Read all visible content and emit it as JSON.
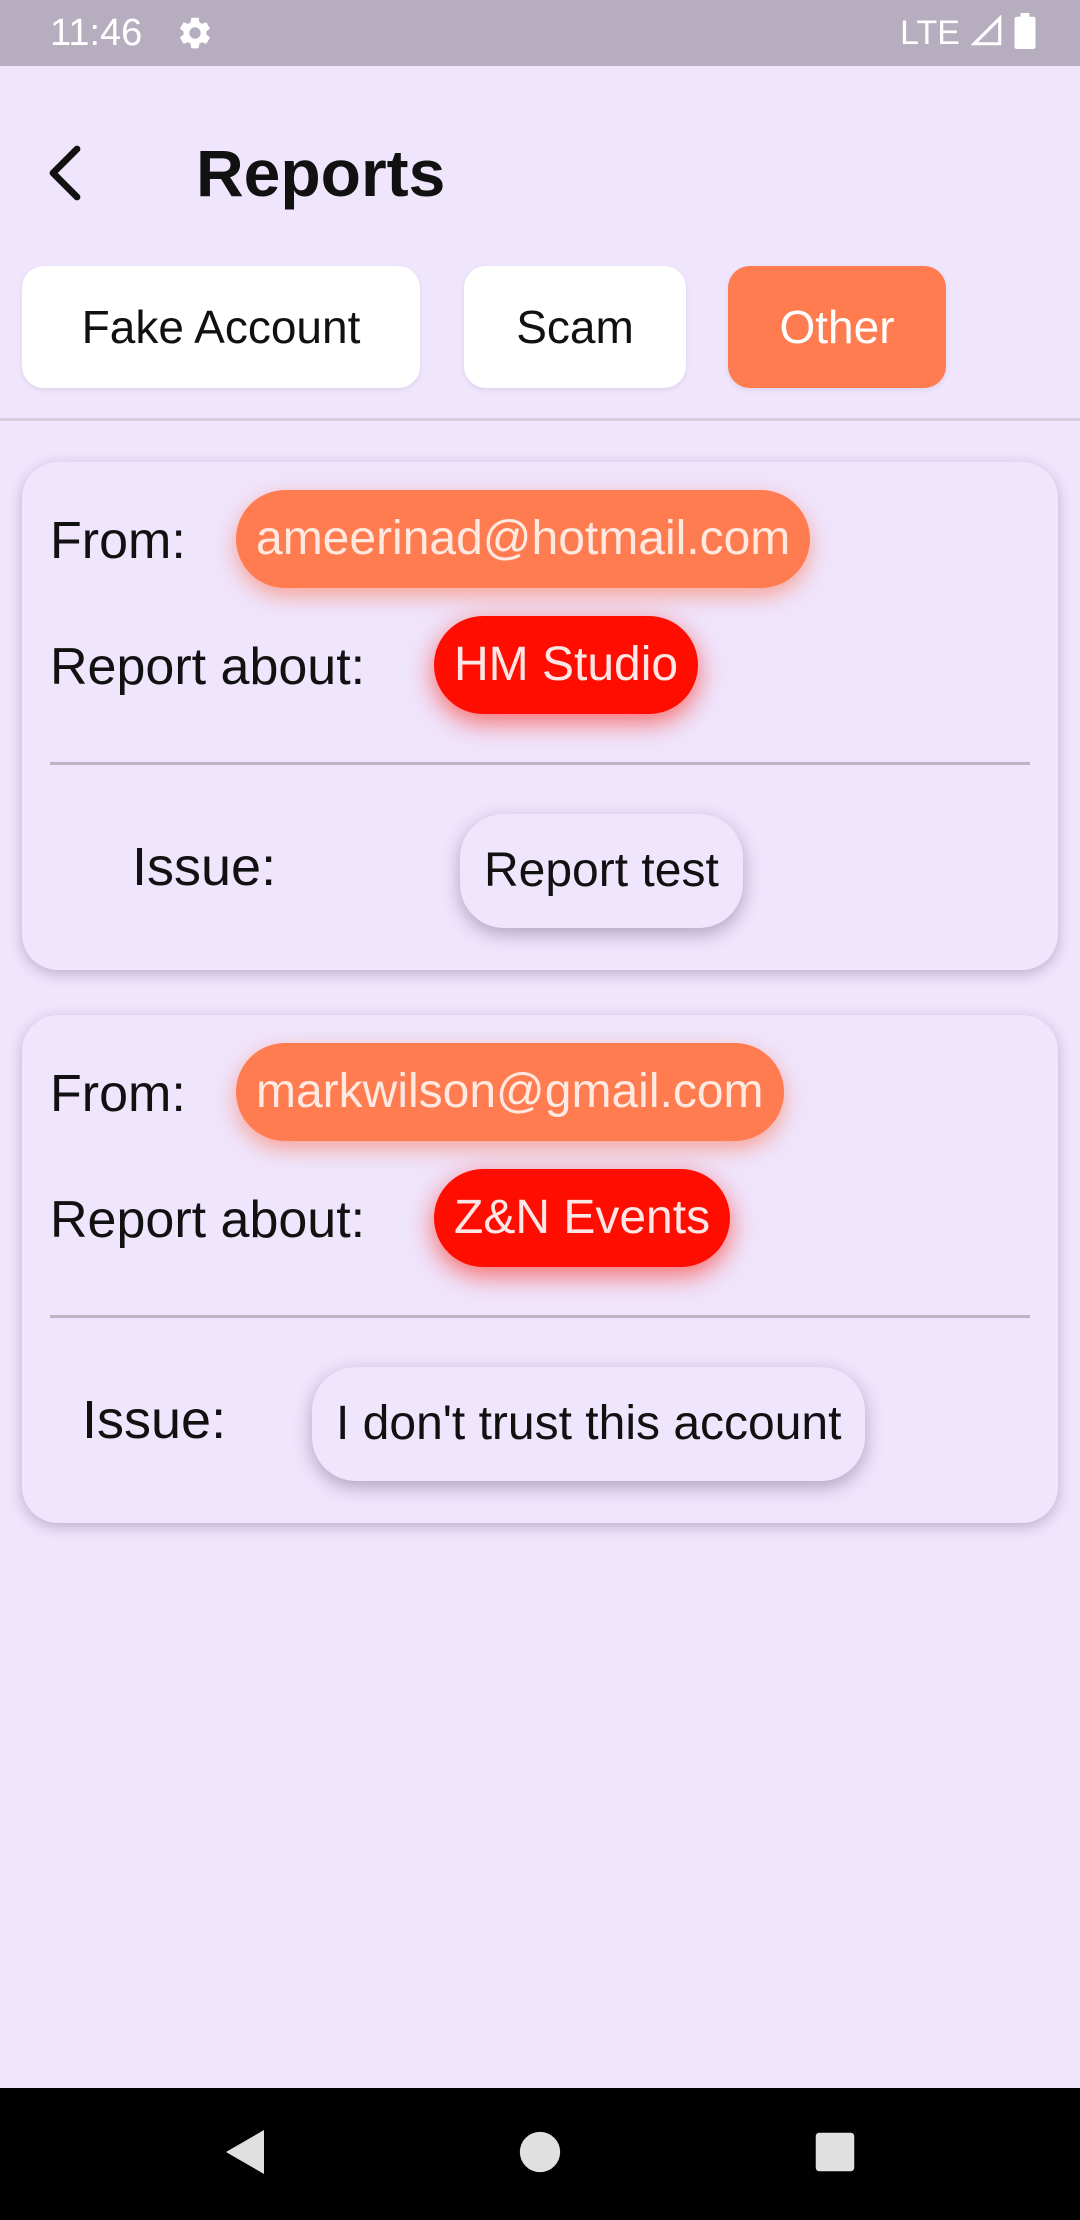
{
  "status_bar": {
    "time": "11:46",
    "network": "LTE",
    "icons": [
      "gear-icon",
      "signal-icon",
      "battery-icon"
    ]
  },
  "header": {
    "title": "Reports",
    "back_icon": "back-arrow-icon"
  },
  "filters": {
    "tabs": [
      {
        "label": "Fake Account",
        "active": false
      },
      {
        "label": "Scam",
        "active": false
      },
      {
        "label": "Other",
        "active": true
      }
    ]
  },
  "reports": [
    {
      "from_label": "From:",
      "from": "ameerinad@hotmail.com",
      "about_label": "Report about:",
      "about": "HM Studio",
      "issue_label": "Issue:",
      "issue": "Report test"
    },
    {
      "from_label": "From:",
      "from": "markwilson@gmail.com",
      "about_label": "Report about:",
      "about": "Z&N Events",
      "issue_label": "Issue:",
      "issue": "I don't trust this account"
    }
  ],
  "colors": {
    "background": "#efe5fd",
    "status_bar": "#b6adbe",
    "accent_orange": "#ff7b50",
    "accent_red": "#ff0d00"
  },
  "nav_bar": {
    "icons": [
      "nav-back-icon",
      "nav-home-icon",
      "nav-recents-icon"
    ]
  }
}
